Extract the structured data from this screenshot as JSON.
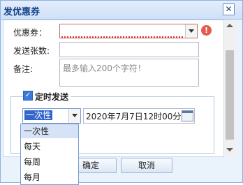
{
  "window": {
    "title": "发优惠券",
    "close_glyph": "✕"
  },
  "form": {
    "coupon_label": "优惠券：",
    "count_label": "发送张数:",
    "note_label": "备注:",
    "note_placeholder": "最多输入200个字符！",
    "warning_glyph": "!"
  },
  "schedule": {
    "legend": "定时发送",
    "checked": true,
    "frequency_selected": "一次性",
    "datetime": "2020年7月7日12时00分",
    "options": [
      "一次性",
      "每天",
      "每周",
      "每月"
    ]
  },
  "buttons": {
    "confirm": "确定",
    "cancel": "取消"
  },
  "colors": {
    "accent": "#3366cc",
    "error": "#e35b4c"
  }
}
